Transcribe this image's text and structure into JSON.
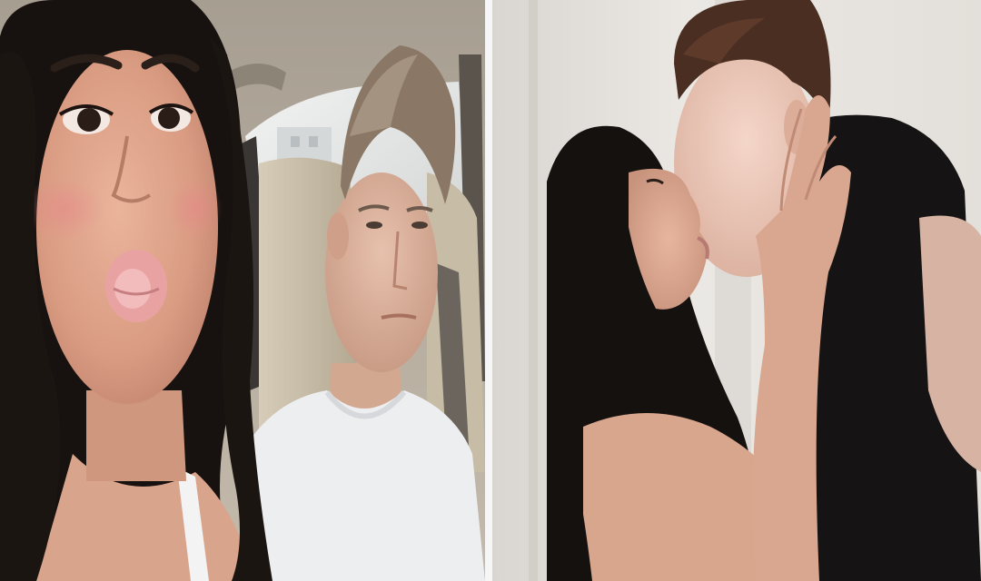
{
  "image": {
    "layout": "two-photo-collage",
    "panels": [
      {
        "id": "left",
        "scene": "car-interior",
        "subjects": [
          "woman-pouting",
          "man-white-tshirt"
        ]
      },
      {
        "id": "right",
        "scene": "indoor-white-wall",
        "subjects": [
          "woman-long-dark-hair",
          "man-black-shirt"
        ]
      }
    ],
    "palette": {
      "car_headliner": "#bdb4a6",
      "car_seat": "#c9bea9",
      "window_light": "#e4e7e8",
      "skin": "#e0aa92",
      "hair_dark": "#17120f",
      "hair_light": "#8a7765",
      "tshirt_white": "#eef0f2",
      "wall": "#e6e3de",
      "shirt_black": "#151313"
    }
  }
}
